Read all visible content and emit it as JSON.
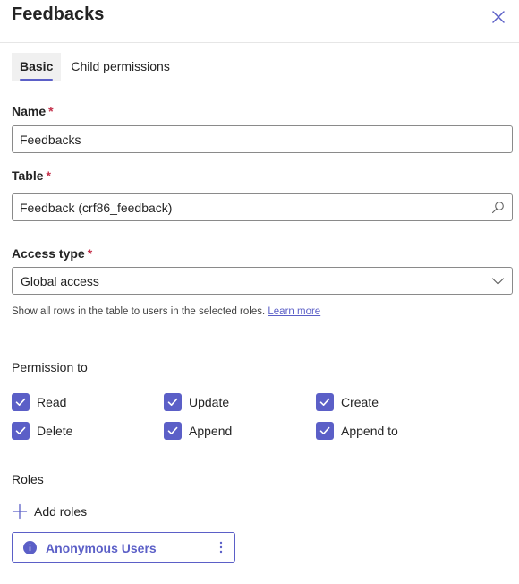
{
  "header": {
    "title": "Feedbacks"
  },
  "tabs": [
    {
      "label": "Basic",
      "active": true
    },
    {
      "label": "Child permissions",
      "active": false
    }
  ],
  "form": {
    "name": {
      "label": "Name",
      "required_mark": "*",
      "value": "Feedbacks"
    },
    "table": {
      "label": "Table",
      "required_mark": "*",
      "value": "Feedback (crf86_feedback)",
      "icon": "search-icon"
    },
    "access_type": {
      "label": "Access type",
      "required_mark": "*",
      "selected": "Global access",
      "icon": "chevron-down-icon",
      "helper_text": "Show all rows in the table to users in the selected roles.",
      "helper_link": "Learn more"
    }
  },
  "permissions": {
    "label": "Permission to",
    "items": [
      {
        "label": "Read",
        "checked": true
      },
      {
        "label": "Update",
        "checked": true
      },
      {
        "label": "Create",
        "checked": true
      },
      {
        "label": "Delete",
        "checked": true
      },
      {
        "label": "Append",
        "checked": true
      },
      {
        "label": "Append to",
        "checked": true
      }
    ]
  },
  "roles": {
    "label": "Roles",
    "add_label": "Add roles",
    "items": [
      {
        "label": "Anonymous Users",
        "icon": "info-icon"
      }
    ]
  },
  "colors": {
    "accent": "#5b5fc7",
    "required": "#c4314b",
    "border": "#8a8a8a",
    "divider": "#e6e6e6"
  }
}
